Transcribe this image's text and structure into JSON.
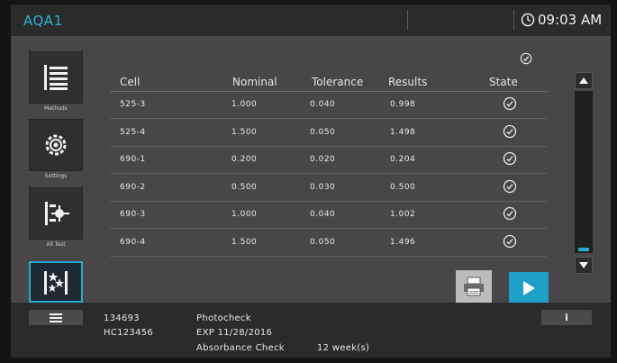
{
  "header": {
    "app_title": "AQA1",
    "time": "09:03 AM"
  },
  "sidebar": {
    "items": [
      {
        "label": "Methods",
        "icon": "methods-icon"
      },
      {
        "label": "Settings",
        "icon": "settings-icon"
      },
      {
        "label": "All Test",
        "icon": "all-test-icon"
      },
      {
        "label": "",
        "icon": "favorites-icon"
      }
    ]
  },
  "table": {
    "columns": [
      "Cell",
      "Nominal",
      "Tolerance",
      "Results",
      "State"
    ],
    "rows": [
      {
        "cell": "525-3",
        "nominal": "1.000",
        "tolerance": "0.040",
        "results": "0.998",
        "state": "check"
      },
      {
        "cell": "525-4",
        "nominal": "1.500",
        "tolerance": "0.050",
        "results": "1.498",
        "state": "check"
      },
      {
        "cell": "690-1",
        "nominal": "0.200",
        "tolerance": "0.020",
        "results": "0.204",
        "state": "check"
      },
      {
        "cell": "690-2",
        "nominal": "0.500",
        "tolerance": "0.030",
        "results": "0.500",
        "state": "check"
      },
      {
        "cell": "690-3",
        "nominal": "1.000",
        "tolerance": "0.040",
        "results": "1.002",
        "state": "check"
      },
      {
        "cell": "690-4",
        "nominal": "1.500",
        "tolerance": "0.050",
        "results": "1.496",
        "state": "check"
      }
    ]
  },
  "footer": {
    "id": "134693",
    "serial": "HC123456",
    "check_name": "Photocheck",
    "expiry": "EXP 11/28/2016",
    "check_type": "Absorbance Check",
    "interval": "12 week(s)",
    "info_label": "i"
  },
  "colors": {
    "accent": "#2aa7cc",
    "title": "#2fb1d6",
    "background": "#474747",
    "bar": "#2b2b2b"
  }
}
